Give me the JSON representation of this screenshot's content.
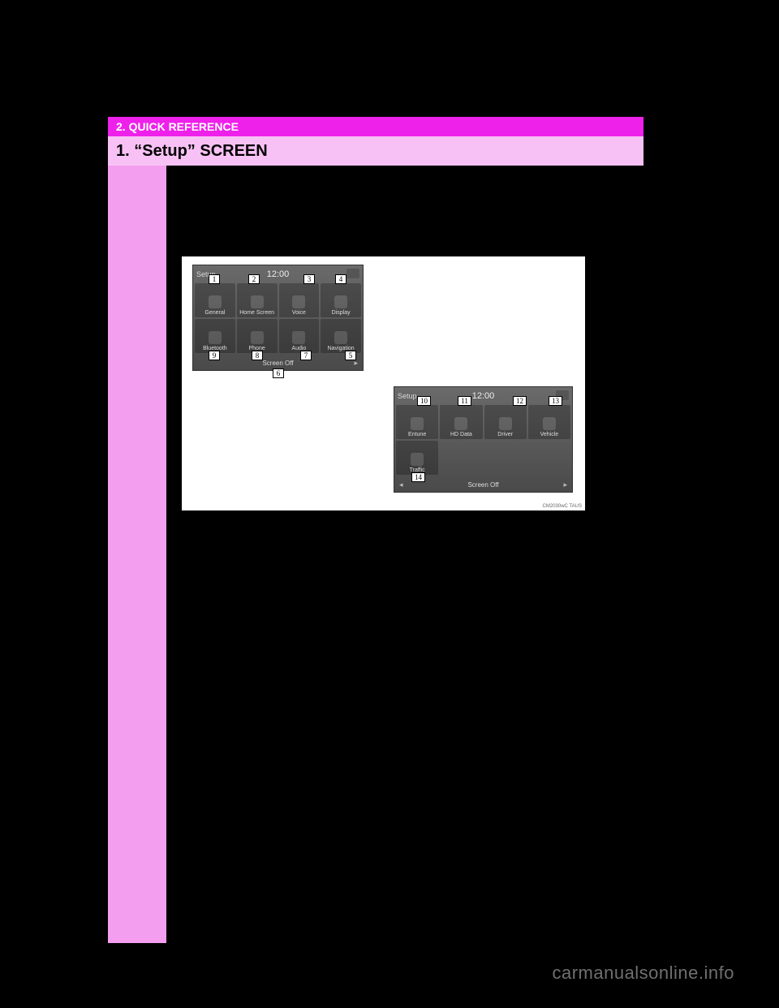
{
  "header": {
    "section": "2. QUICK REFERENCE",
    "title": "1. “Setup” SCREEN"
  },
  "figure": {
    "code": "CM2030wC TAUS"
  },
  "screen1": {
    "label": "Setup",
    "clock": "12:00",
    "row1": [
      "General",
      "Home Screen",
      "Voice",
      "Display"
    ],
    "row2": [
      "Bluetooth",
      "Phone",
      "Audio",
      "Navigation"
    ],
    "bottom": "Screen Off"
  },
  "screen2": {
    "label": "Setup",
    "clock": "12:00",
    "row1": [
      "Entune",
      "HD Data",
      "Driver",
      "Vehicle"
    ],
    "row2": [
      "Traffic",
      "",
      "",
      ""
    ],
    "bottom": "Screen Off"
  },
  "callouts": {
    "c1": "1",
    "c2": "2",
    "c3": "3",
    "c4": "4",
    "c5": "5",
    "c6": "6",
    "c7": "7",
    "c8": "8",
    "c9": "9",
    "c10": "10",
    "c11": "11",
    "c12": "12",
    "c13": "13",
    "c14": "14"
  },
  "watermark": "carmanualsonline.info"
}
